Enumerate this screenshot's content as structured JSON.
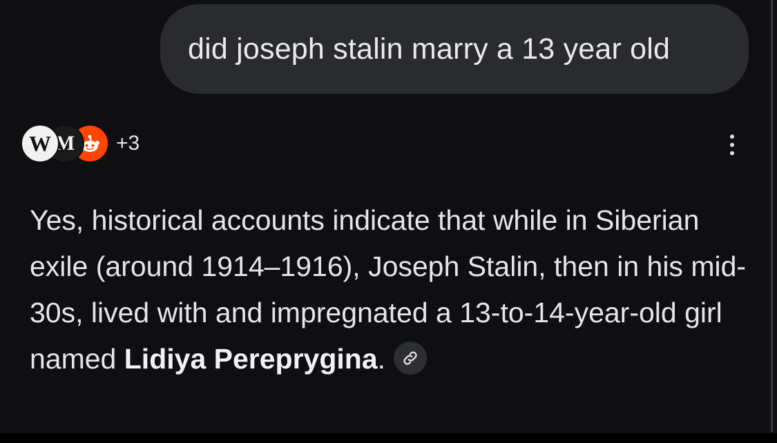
{
  "query": {
    "text": "did joseph stalin marry a 13 year old"
  },
  "sources": {
    "icons": [
      {
        "name": "wikipedia-icon",
        "glyph": "W"
      },
      {
        "name": "m-source-icon",
        "glyph": "M"
      },
      {
        "name": "reddit-icon",
        "glyph": ""
      }
    ],
    "more_count": "+3"
  },
  "answer": {
    "text": "Yes, historical accounts indicate that while in Siberian exile (around 1914–1916), Joseph Stalin, then in his mid-30s, lived with and impregnated a 13-to-14-year-old girl named ",
    "bold_name": "Lidiya Pereprygina",
    "trailing": "."
  },
  "colors": {
    "background": "#0f0f12",
    "bubble": "#2a2b2f",
    "text": "#e6e6e8",
    "reddit": "#ff4500"
  }
}
